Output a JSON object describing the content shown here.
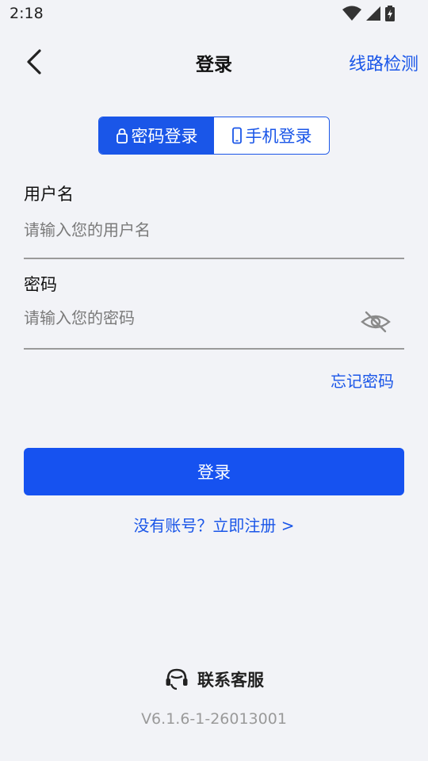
{
  "status_bar": {
    "time": "2:18"
  },
  "header": {
    "title": "登录",
    "route_check": "线路检测"
  },
  "tabs": [
    {
      "label": "密码登录",
      "icon": "lock-icon",
      "active": true
    },
    {
      "label": "手机登录",
      "icon": "phone-icon",
      "active": false
    }
  ],
  "form": {
    "username_label": "用户名",
    "username_placeholder": "请输入您的用户名",
    "username_value": "",
    "password_label": "密码",
    "password_placeholder": "请输入您的密码",
    "password_value": "",
    "forgot": "忘记密码"
  },
  "login_button": "登录",
  "register_link": "没有账号？立即注册 >",
  "footer": {
    "support": "联系客服",
    "version": "V6.1.6-1-26013001"
  },
  "colors": {
    "accent": "#1a56e8",
    "button": "#1652f0",
    "background": "#f2f3f7"
  }
}
